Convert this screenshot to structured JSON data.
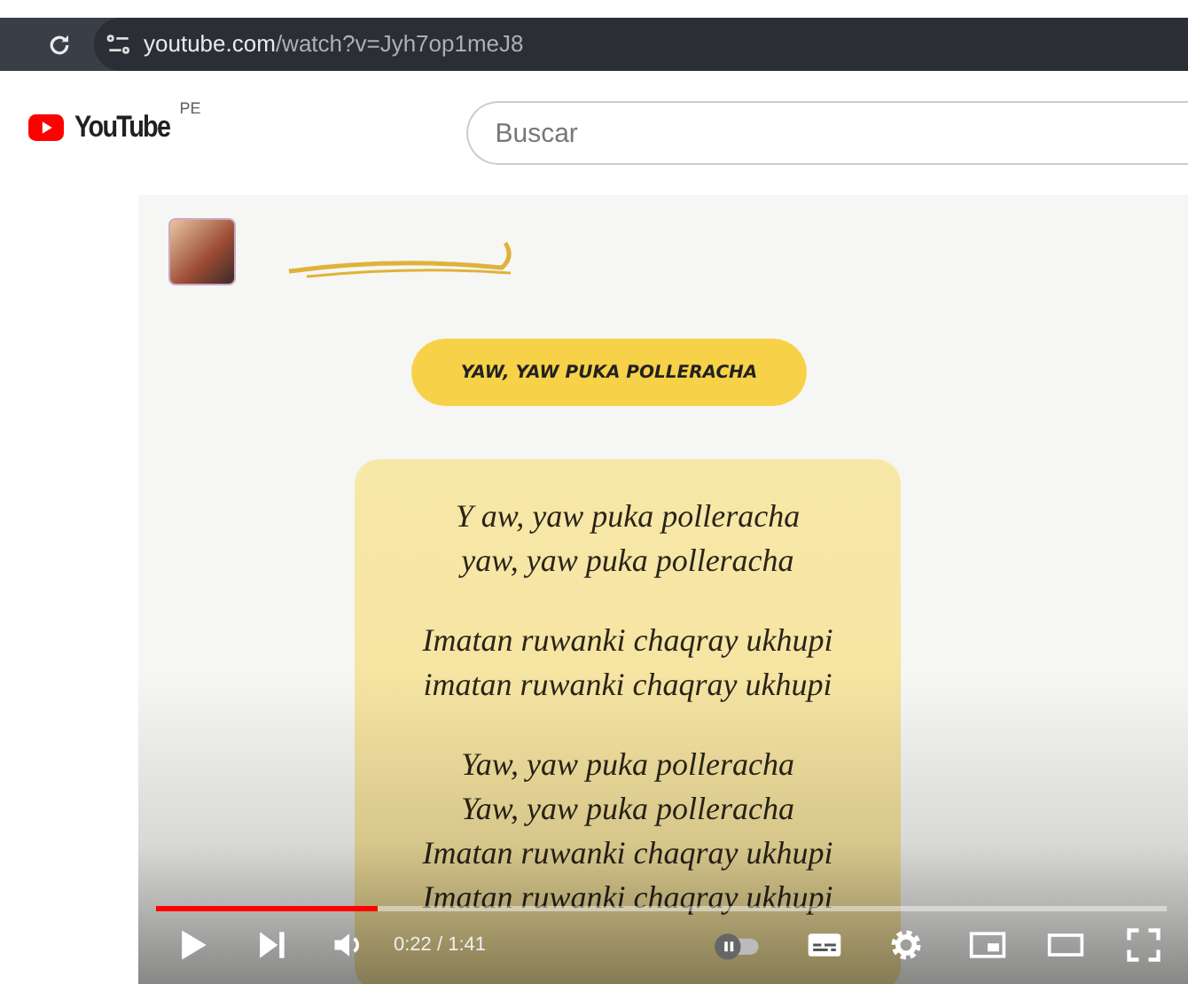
{
  "browser": {
    "url_domain": "youtube.com",
    "url_path": "/watch?v=Jyh7op1meJ8"
  },
  "header": {
    "logo_text": "YouTube",
    "country": "PE",
    "search": {
      "placeholder": "Buscar"
    }
  },
  "video": {
    "title": "YAW, YAW PUKA POLLERACHA",
    "stanzas": [
      [
        "Y aw, yaw puka polleracha",
        "yaw, yaw puka polleracha"
      ],
      [
        "Imatan ruwanki chaqray ukhupi",
        "imatan ruwanki chaqray ukhupi"
      ],
      [
        "Yaw, yaw puka polleracha",
        "Yaw, yaw puka polleracha",
        "Imatan ruwanki chaqray ukhupi",
        "Imatan ruwanki chaqray ukhupi"
      ]
    ]
  },
  "player": {
    "playing": false,
    "progress": {
      "level": 0.22
    },
    "time": "0:22 / 1:41",
    "autoplay": {
      "on": false
    }
  }
}
